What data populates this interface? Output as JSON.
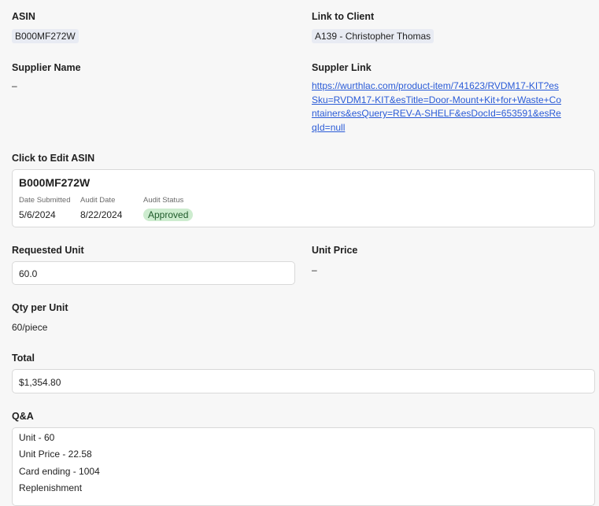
{
  "asin": {
    "label": "ASIN",
    "value": "B000MF272W"
  },
  "client": {
    "label": "Link to Client",
    "value": "A139 - Christopher Thomas"
  },
  "supplier_name": {
    "label": "Supplier Name",
    "value": "–"
  },
  "supplier_link": {
    "label": "Suppler Link",
    "url": "https://wurthlac.com/product-item/741623/RVDM17-KIT?esSku=RVDM17-KIT&esTitle=Door-Mount+Kit+for+Waste+Containers&esQuery=REV-A-SHELF&esDocId=653591&esReqId=null"
  },
  "edit_card": {
    "label": "Click to Edit ASIN",
    "title": "B000MF272W",
    "date_submitted_label": "Date Submitted",
    "date_submitted": "5/6/2024",
    "audit_date_label": "Audit Date",
    "audit_date": "8/22/2024",
    "audit_status_label": "Audit Status",
    "audit_status": "Approved"
  },
  "requested_unit": {
    "label": "Requested Unit",
    "value": "60.0"
  },
  "unit_price": {
    "label": "Unit Price",
    "value": "–"
  },
  "qty_per_unit": {
    "label": "Qty per Unit",
    "value": "60/piece"
  },
  "total": {
    "label": "Total",
    "value": "$1,354.80"
  },
  "qa": {
    "label": "Q&A",
    "lines": [
      "Unit - 60",
      "Unit Price - 22.58",
      "Card ending - 1004",
      "Replenishment"
    ]
  },
  "colors": {
    "link": "#2a5bd7",
    "badge_bg": "#cdeccf",
    "chip_bg": "#e8ebf3"
  }
}
